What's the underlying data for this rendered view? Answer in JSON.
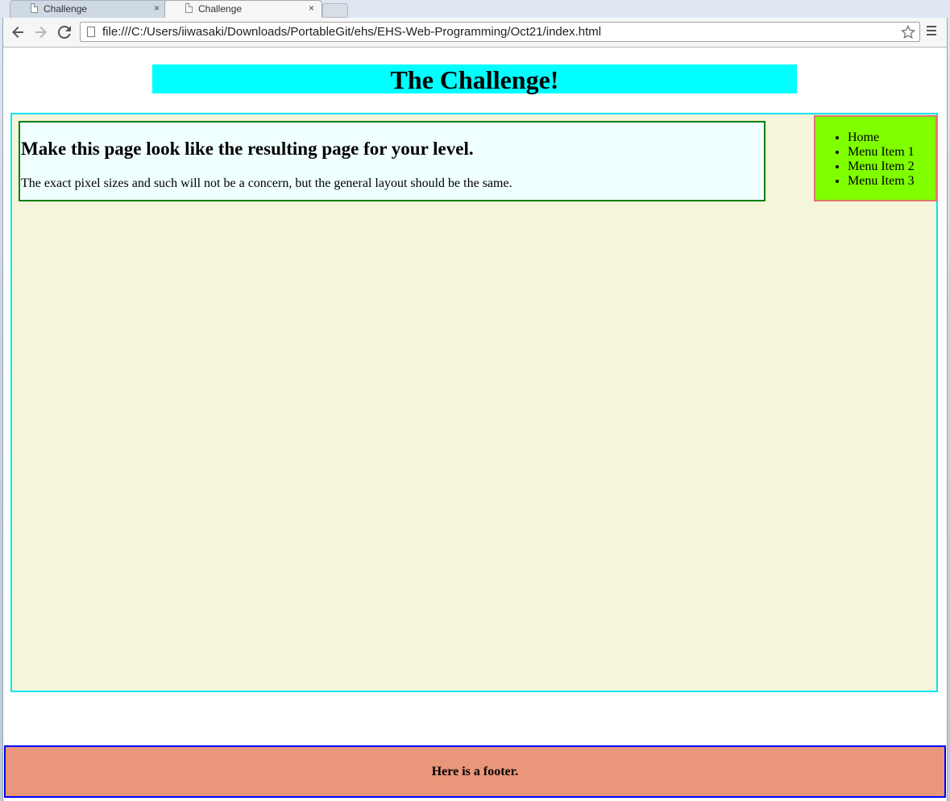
{
  "browser": {
    "tabs": [
      {
        "label": "Challenge",
        "active": false
      },
      {
        "label": "Challenge",
        "active": true
      }
    ],
    "close_glyph": "×",
    "url": "file:///C:/Users/iiwasaki/Downloads/PortableGit/ehs/EHS-Web-Programming/Oct21/index.html",
    "icons": {
      "back": "back-arrow-icon",
      "forward": "forward-arrow-icon",
      "reload": "reload-icon",
      "bookmark": "star-icon",
      "menu": "hamburger-menu-icon"
    }
  },
  "page": {
    "title": "The Challenge!",
    "main": {
      "heading": "Make this page look like the resulting page for your level.",
      "text": "The exact pixel sizes and such will not be a concern, but the general layout should be the same."
    },
    "nav": {
      "items": [
        "Home",
        "Menu Item 1",
        "Menu Item 2",
        "Menu Item 3"
      ]
    },
    "footer": {
      "text": "Here is a footer."
    }
  },
  "colors": {
    "title_bg": "#00ffff",
    "container_bg": "#f5f5dc",
    "container_border": "#00e5ee",
    "content_bg": "#f0ffff",
    "content_border": "#008000",
    "nav_bg": "#7fff00",
    "nav_border": "#e0776a",
    "footer_bg": "#e9967a",
    "footer_border": "#0000ff"
  }
}
